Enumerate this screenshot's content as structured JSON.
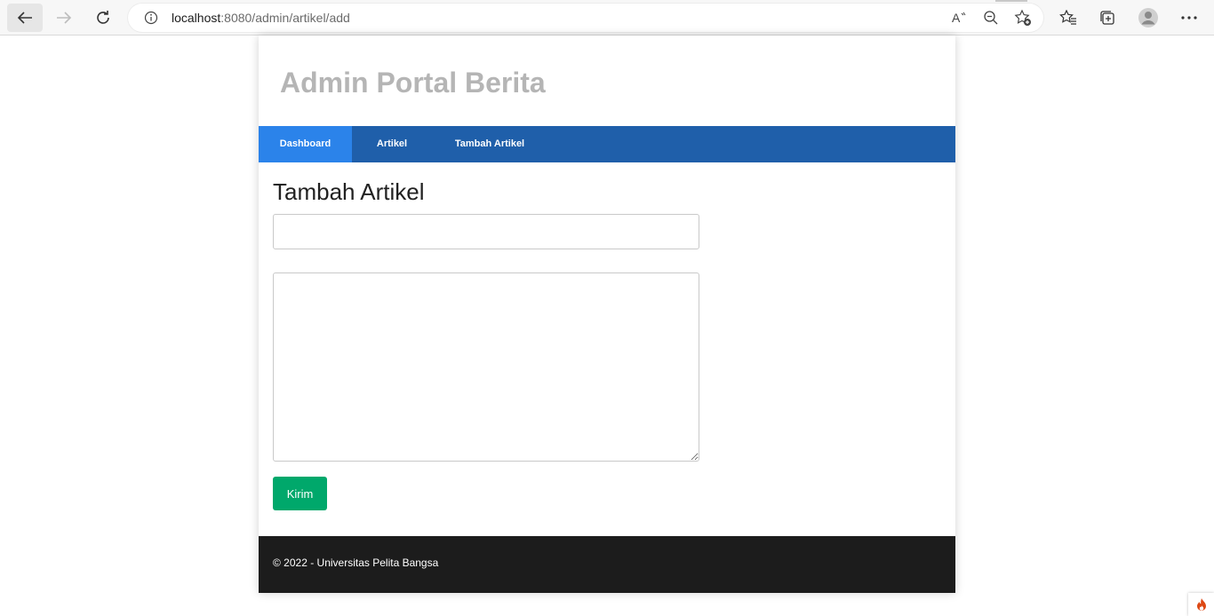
{
  "browser": {
    "url_host": "localhost",
    "url_path": ":8080/admin/artikel/add"
  },
  "site": {
    "title": "Admin Portal Berita"
  },
  "nav": {
    "items": [
      {
        "label": "Dashboard",
        "active": true
      },
      {
        "label": "Artikel",
        "active": false
      },
      {
        "label": "Tambah Artikel",
        "active": false
      }
    ]
  },
  "form": {
    "heading": "Tambah Artikel",
    "title_value": "",
    "content_value": "",
    "submit_label": "Kirim"
  },
  "footer": {
    "text": "© 2022 - Universitas Pelita Bangsa"
  },
  "colors": {
    "nav_bg": "#1f5faa",
    "nav_active": "#2b83ea",
    "submit_bg": "#00a86b",
    "footer_bg": "#1c1c1c",
    "title_color": "#b5b5b5"
  },
  "icons": [
    "back-arrow-icon",
    "forward-arrow-icon",
    "reload-icon",
    "info-icon",
    "read-aloud-icon",
    "zoom-out-icon",
    "add-favorite-icon",
    "favorites-icon",
    "collections-icon",
    "profile-icon",
    "more-icon",
    "codeigniter-flame-icon"
  ]
}
